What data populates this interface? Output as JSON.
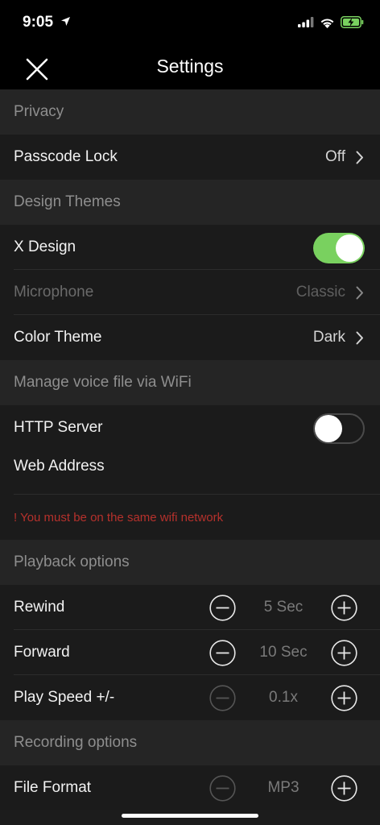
{
  "status": {
    "time": "9:05"
  },
  "nav": {
    "title": "Settings"
  },
  "sections": {
    "privacy": {
      "header": "Privacy",
      "passcode_label": "Passcode Lock",
      "passcode_value": "Off"
    },
    "design": {
      "header": "Design Themes",
      "x_design_label": "X Design",
      "x_design_on": true,
      "microphone_label": "Microphone",
      "microphone_value": "Classic",
      "color_theme_label": "Color Theme",
      "color_theme_value": "Dark"
    },
    "wifi": {
      "header": "Manage voice file via WiFi",
      "http_label": "HTTP Server",
      "http_on": false,
      "web_address_label": "Web Address",
      "warning": "! You must be on the same wifi network"
    },
    "playback": {
      "header": "Playback options",
      "rewind_label": "Rewind",
      "rewind_value": "5 Sec",
      "forward_label": "Forward",
      "forward_value": "10 Sec",
      "speed_label": "Play Speed +/-",
      "speed_value": "0.1x"
    },
    "recording": {
      "header": "Recording options",
      "format_label": "File Format",
      "format_value": "MP3"
    }
  },
  "colors": {
    "toggle_on": "#79d15f",
    "warning": "#b6312c",
    "battery": "#79d15f"
  },
  "icons": [
    "location-arrow-icon",
    "signal-icon",
    "wifi-icon",
    "battery-charging-icon",
    "close-icon",
    "chevron-right-icon",
    "minus-circle-icon",
    "plus-circle-icon"
  ]
}
